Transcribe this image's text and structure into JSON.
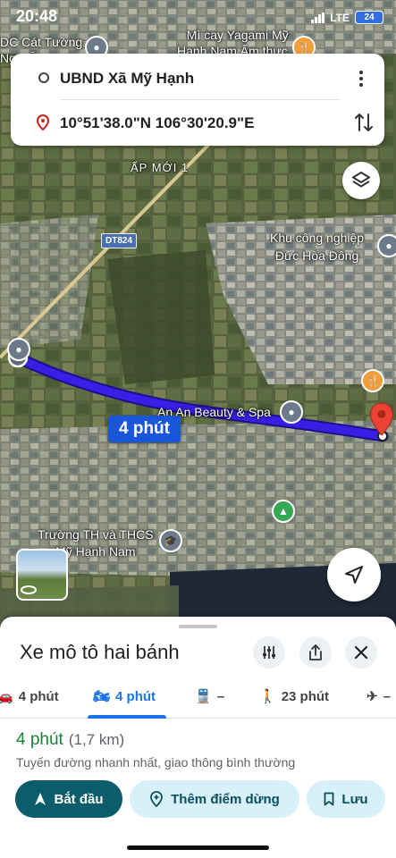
{
  "status": {
    "time": "20:48",
    "network": "LTE",
    "battery": "24"
  },
  "route": {
    "origin": "UBND Xã Mỹ Hạnh",
    "destination": "10°51'38.0\"N 106°30'20.9\"E"
  },
  "map": {
    "labels": {
      "place_top_left": "DC Cát Tường\nNguyễn...",
      "restaurant_top": "Mì cay Yagami Mỹ\nHạnh Nam Ẩm thực...",
      "hamlet": "ẤP MỚI 1",
      "road": "DT824",
      "industrial": "Khu công nghiệp\nĐức Hòa Đông",
      "spa": "An An Beauty & Spa",
      "school": "Trường TH và THCS\nMỹ Hạnh Nam"
    },
    "route_time_badge": "4 phút"
  },
  "sheet": {
    "title": "Xe mô tô hai bánh",
    "tabs": [
      {
        "icon": "car-icon",
        "label": "4 phút"
      },
      {
        "icon": "motorbike-icon",
        "label": "4 phút",
        "active": true
      },
      {
        "icon": "transit-icon",
        "label": "–"
      },
      {
        "icon": "walk-icon",
        "label": "23 phút"
      },
      {
        "icon": "flight-icon",
        "label": "–"
      }
    ],
    "eta": "4 phút",
    "distance": "(1,7 km)",
    "description": "Tuyến đường nhanh nhất, giao thông bình thường",
    "actions": {
      "start": "Bắt đầu",
      "add_stop": "Thêm điểm dừng",
      "save": "Lưu"
    }
  },
  "colors": {
    "route": "#3b1ee6",
    "accent": "#1a73e8",
    "eta": "#188038",
    "start_button": "#0b5d6b"
  }
}
